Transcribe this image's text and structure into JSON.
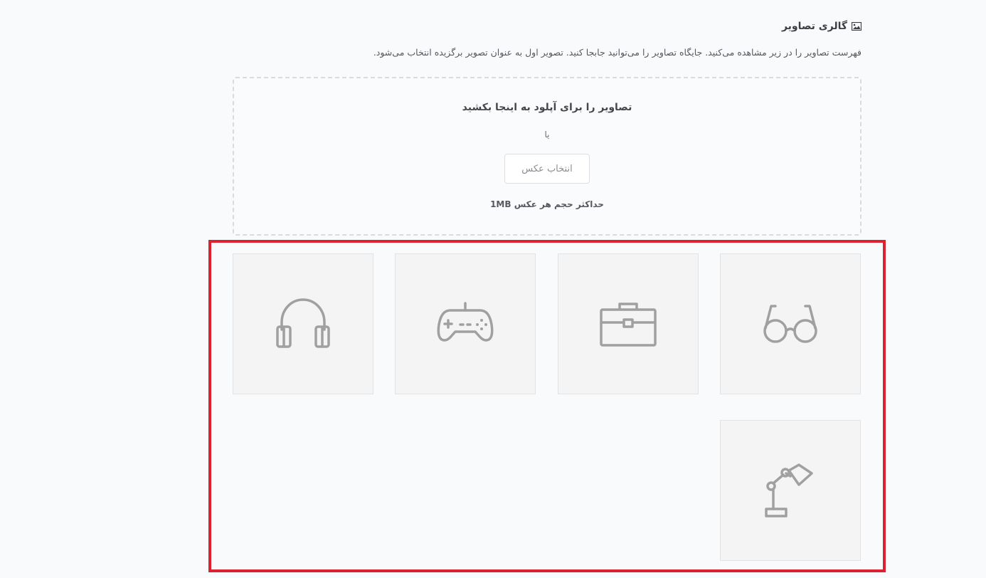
{
  "gallery": {
    "title": "گالری تصاویر",
    "title_icon": "image-icon",
    "description": "فهرست تصاویر را در زیر مشاهده می‌کنید. جایگاه تصاویر را می‌توانید جابجا کنید. تصویر اول به عنوان تصویر برگزیده انتخاب می‌شود."
  },
  "dropzone": {
    "title": "تصاویر را برای آپلود به اینجا بکشید",
    "or_text": "یا",
    "select_button": "انتخاب عکس",
    "size_limit": "حداکثر حجم هر عکس 1MB"
  },
  "images": [
    {
      "icon": "glasses-icon"
    },
    {
      "icon": "briefcase-icon"
    },
    {
      "icon": "gamepad-icon"
    },
    {
      "icon": "headphones-icon"
    },
    {
      "icon": "desk-lamp-icon"
    }
  ],
  "colors": {
    "highlight_border": "#dc2130",
    "tile_background": "#f4f4f4",
    "icon_stroke": "#a0a0a0"
  }
}
